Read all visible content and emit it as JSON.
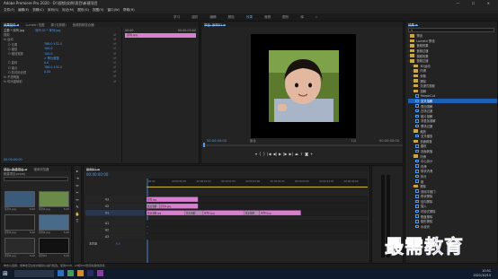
{
  "app": {
    "title": "Adobe Premiere Pro 2020 - D:\\视频\\实例\\项目\\新建项目",
    "window_controls": "— ☐ ✕"
  },
  "menu": [
    "文件(F)",
    "编辑(E)",
    "剪辑(C)",
    "序列(S)",
    "标记(M)",
    "图形(G)",
    "视图(V)",
    "窗口(W)",
    "帮助(H)"
  ],
  "workspaces": [
    "学习",
    "组件",
    "编辑",
    "颜色",
    "效果",
    "音频",
    "图形",
    "库",
    "»"
  ],
  "active_workspace_index": 4,
  "effect_controls": {
    "tabs": [
      "效果控件 ≡",
      "Lumetri 范围",
      "源:(无剪辑)",
      "音频剪辑混合器:"
    ],
    "clip_label": "主要 * 序列.jpg",
    "seq_label": "序列 01 * 序列.jpg",
    "rows": [
      {
        "label": "视频",
        "value": ""
      },
      {
        "label": "fx 运动",
        "value": ""
      },
      {
        "label": "Ö 位置",
        "value": "768.0  432.0"
      },
      {
        "label": "Ö 缩放",
        "value": "100.0"
      },
      {
        "label": "Ö 缩放宽度",
        "value": "100.0"
      },
      {
        "label": "",
        "value": "✔ 等比缩放"
      },
      {
        "label": "Ö 旋转",
        "value": "0.0"
      },
      {
        "label": "Ö 锚点",
        "value": "768.0  432.0"
      },
      {
        "label": "Ö 防闪烁滤镜",
        "value": "0.00"
      },
      {
        "label": "fx 不透明度",
        "value": ""
      },
      {
        "label": "fx 时间重映射",
        "value": ""
      }
    ],
    "mini_timeline": {
      "start": "00:00",
      "end": "00:00:05:00"
    },
    "footer_tc": "00:00:00:00"
  },
  "program_monitor": {
    "tab": "节目: 序列01 ≡",
    "timecode": "00:00:00:00",
    "fit": "适合",
    "zoom": "1/2",
    "duration": "00:00:05:00"
  },
  "effects_panel": {
    "tab": "效果 ≡",
    "items": [
      {
        "label": "预设",
        "level": 0,
        "type": "folder"
      },
      {
        "label": "Lumetri 预设",
        "level": 0,
        "type": "folder"
      },
      {
        "label": "音频效果",
        "level": 0,
        "type": "folder"
      },
      {
        "label": "音频过渡",
        "level": 0,
        "type": "folder"
      },
      {
        "label": "视频效果",
        "level": 0,
        "type": "folder"
      },
      {
        "label": "视频过渡",
        "level": 0,
        "type": "folder"
      },
      {
        "label": "3D运动",
        "level": 1,
        "type": "folder"
      },
      {
        "label": "内滑",
        "level": 1,
        "type": "folder"
      },
      {
        "label": "划像",
        "level": 1,
        "type": "folder"
      },
      {
        "label": "擦除",
        "level": 1,
        "type": "folder"
      },
      {
        "label": "沉浸式视频",
        "level": 1,
        "type": "folder"
      },
      {
        "label": "溶解",
        "level": 1,
        "type": "folder"
      },
      {
        "label": "MorphCut",
        "level": 2,
        "type": "fx"
      },
      {
        "label": "交叉溶解",
        "level": 2,
        "type": "fx",
        "selected": true
      },
      {
        "label": "叠加溶解",
        "level": 2,
        "type": "fx"
      },
      {
        "label": "白场过渡",
        "level": 2,
        "type": "fx"
      },
      {
        "label": "胶片溶解",
        "level": 2,
        "type": "fx"
      },
      {
        "label": "非叠加溶解",
        "level": 2,
        "type": "fx"
      },
      {
        "label": "黑场过渡",
        "level": 2,
        "type": "fx"
      },
      {
        "label": "缩放",
        "level": 1,
        "type": "folder"
      },
      {
        "label": "交叉缩放",
        "level": 2,
        "type": "fx"
      },
      {
        "label": "页面剥落",
        "level": 1,
        "type": "folder"
      },
      {
        "label": "翻页",
        "level": 2,
        "type": "fx"
      },
      {
        "label": "页面剥落",
        "level": 2,
        "type": "fx"
      },
      {
        "label": "内滑",
        "level": 1,
        "type": "folder"
      },
      {
        "label": "中心拆分",
        "level": 2,
        "type": "fx"
      },
      {
        "label": "内滑",
        "level": 2,
        "type": "fx"
      },
      {
        "label": "带状内滑",
        "level": 2,
        "type": "fx"
      },
      {
        "label": "拆分",
        "level": 2,
        "type": "fx"
      },
      {
        "label": "推",
        "level": 2,
        "type": "fx"
      },
      {
        "label": "擦除",
        "level": 1,
        "type": "folder"
      },
      {
        "label": "双侧平推门",
        "level": 2,
        "type": "fx"
      },
      {
        "label": "带状擦除",
        "level": 2,
        "type": "fx"
      },
      {
        "label": "径向擦除",
        "level": 2,
        "type": "fx"
      },
      {
        "label": "插入",
        "level": 2,
        "type": "fx"
      },
      {
        "label": "时钟式擦除",
        "level": 2,
        "type": "fx"
      },
      {
        "label": "棋盘擦除",
        "level": 2,
        "type": "fx"
      },
      {
        "label": "楔形擦除",
        "level": 2,
        "type": "fx"
      },
      {
        "label": "水波块",
        "level": 2,
        "type": "fx"
      }
    ]
  },
  "project_panel": {
    "tabs": [
      "项目: 新建项目 ≡",
      "媒体浏览器"
    ],
    "project_name": "新建项目.prproj",
    "items": [
      {
        "name": "序列1.jpg",
        "duration": "5:00"
      },
      {
        "name": "序列2.jpg",
        "duration": "5:00"
      },
      {
        "name": "序列3.jpg",
        "duration": "5:00"
      },
      {
        "name": "序列4.jpg",
        "duration": "5:00"
      },
      {
        "name": "序列5.jpg",
        "duration": "5:00"
      },
      {
        "name": "序列01",
        "duration": "5:00"
      }
    ]
  },
  "timeline": {
    "tab": "序列01 ≡",
    "timecode": "00:00:00:00",
    "ruler": [
      ":00:00",
      "00:00:00:05",
      "00:00:01:00",
      "00:00:01:05",
      "00:00:02:00",
      "00:00:02:05",
      "00:00:03:00",
      "00:00:03:05",
      "00:00:04:00"
    ],
    "tracks": [
      "V3",
      "V2",
      "V1",
      "A1",
      "A2",
      "A3"
    ],
    "master_label": "主声道",
    "master_value": "0.0",
    "clips": [
      {
        "track": "V3",
        "label": "序列.jpg",
        "start": 0.0,
        "end": 1.0
      },
      {
        "track": "V2",
        "label": "交叉溶解",
        "start": 0.0,
        "end": 0.25,
        "transition": true
      },
      {
        "track": "V2",
        "label": "序列2.jpg",
        "start": 0.25,
        "end": 1.0
      },
      {
        "track": "V1",
        "label": "交叉溶解.jpg",
        "start": 0.0,
        "end": 0.75
      },
      {
        "track": "V1",
        "label": "交叉溶解",
        "start": 0.75,
        "end": 1.1,
        "transition": true
      },
      {
        "track": "V1",
        "label": "序列3.jpg",
        "start": 1.1,
        "end": 1.9
      },
      {
        "track": "V1",
        "label": "交叉溶解",
        "start": 1.9,
        "end": 2.2,
        "transition": true
      },
      {
        "track": "V1",
        "label": "序列4.jpg",
        "start": 2.2,
        "end": 3.0
      }
    ],
    "timeline_span": 4.3
  },
  "status": "单击以选择，或单击空白处并拖动以进行框选。使用Shift、Alt和Ctrl键获得其他选项。",
  "watermark": "最需教育",
  "taskbar": {
    "time": "10:51",
    "date": "2021/10/15"
  }
}
